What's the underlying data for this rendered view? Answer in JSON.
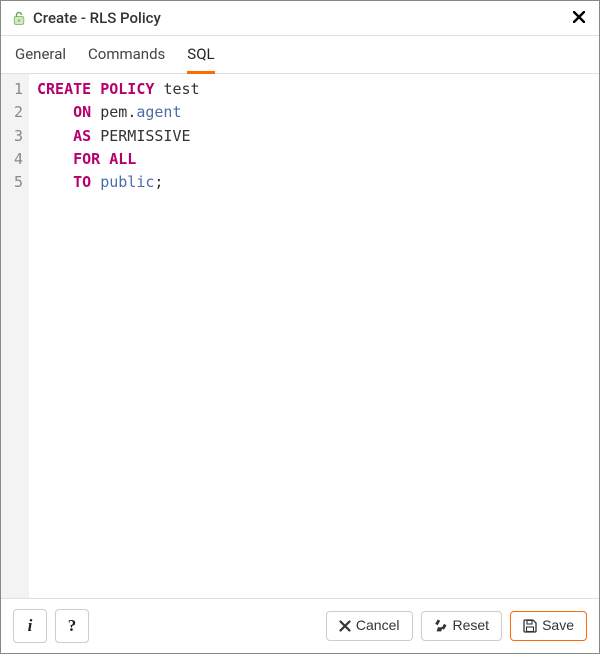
{
  "window": {
    "title": "Create - RLS Policy"
  },
  "tabs": [
    {
      "label": "General",
      "active": false
    },
    {
      "label": "Commands",
      "active": false
    },
    {
      "label": "SQL",
      "active": true
    }
  ],
  "code": {
    "lines": [
      {
        "n": "1",
        "tokens": [
          {
            "t": "CREATE POLICY",
            "cls": "kw"
          },
          {
            "t": " ",
            "cls": ""
          },
          {
            "t": "test",
            "cls": "ident"
          }
        ]
      },
      {
        "n": "2",
        "tokens": [
          {
            "t": "    ",
            "cls": ""
          },
          {
            "t": "ON",
            "cls": "kw"
          },
          {
            "t": " ",
            "cls": ""
          },
          {
            "t": "pem",
            "cls": "schema"
          },
          {
            "t": ".",
            "cls": "punct"
          },
          {
            "t": "agent",
            "cls": "obj"
          }
        ]
      },
      {
        "n": "3",
        "tokens": [
          {
            "t": "    ",
            "cls": ""
          },
          {
            "t": "AS",
            "cls": "kw"
          },
          {
            "t": " ",
            "cls": ""
          },
          {
            "t": "PERMISSIVE",
            "cls": "ident"
          }
        ]
      },
      {
        "n": "4",
        "tokens": [
          {
            "t": "    ",
            "cls": ""
          },
          {
            "t": "FOR ALL",
            "cls": "kw"
          }
        ]
      },
      {
        "n": "5",
        "tokens": [
          {
            "t": "    ",
            "cls": ""
          },
          {
            "t": "TO",
            "cls": "kw"
          },
          {
            "t": " ",
            "cls": ""
          },
          {
            "t": "public",
            "cls": "obj"
          },
          {
            "t": ";",
            "cls": "punct"
          }
        ]
      }
    ]
  },
  "footer": {
    "info_label": "i",
    "help_label": "?",
    "cancel_label": "Cancel",
    "reset_label": "Reset",
    "save_label": "Save"
  }
}
